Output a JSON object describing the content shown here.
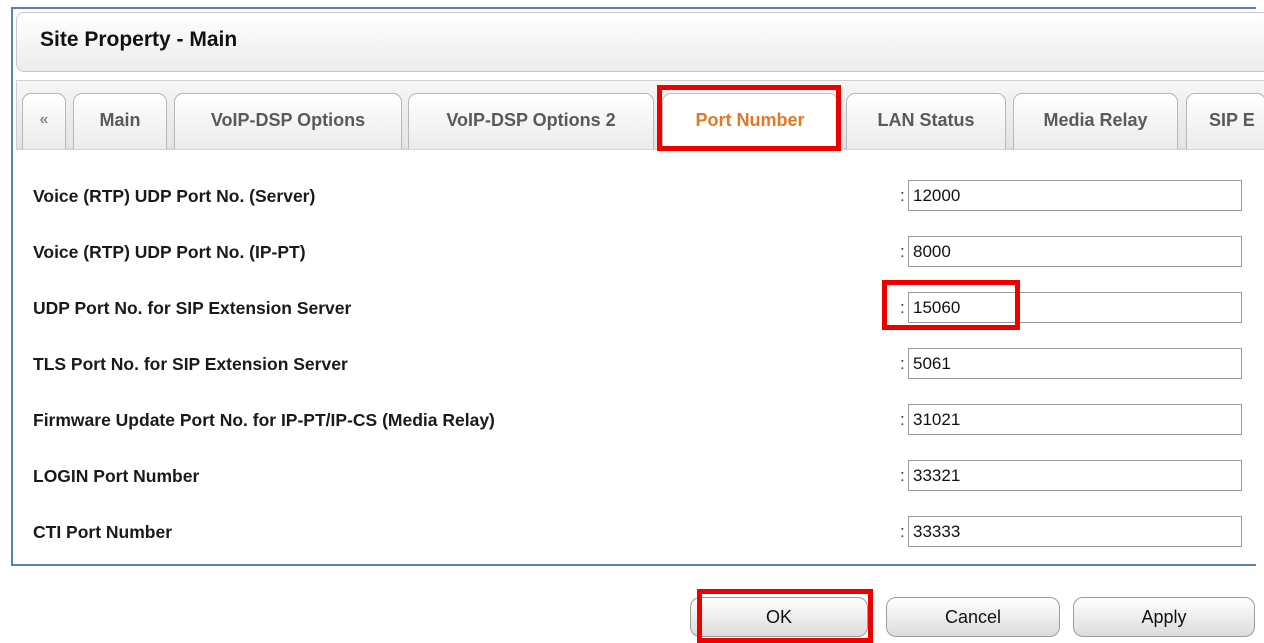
{
  "dialog": {
    "title": "Site Property - Main"
  },
  "tabs": [
    {
      "label": "«",
      "icon": "double-chevron-left-icon"
    },
    {
      "label": "Main"
    },
    {
      "label": "VoIP-DSP Options"
    },
    {
      "label": "VoIP-DSP Options 2"
    },
    {
      "label": "Port Number",
      "active": true
    },
    {
      "label": "LAN Status"
    },
    {
      "label": "Media Relay"
    },
    {
      "label": "SIP E"
    }
  ],
  "fields": [
    {
      "label": "Voice (RTP) UDP Port No. (Server)",
      "value": "12000"
    },
    {
      "label": "Voice (RTP) UDP Port No. (IP-PT)",
      "value": "8000"
    },
    {
      "label": "UDP Port No. for SIP Extension Server",
      "value": "15060"
    },
    {
      "label": "TLS Port No. for SIP Extension Server",
      "value": "5061"
    },
    {
      "label": "Firmware Update Port No. for IP-PT/IP-CS (Media Relay)",
      "value": "31021"
    },
    {
      "label": "LOGIN Port Number",
      "value": "33321"
    },
    {
      "label": "CTI Port Number",
      "value": "33333"
    }
  ],
  "separator": ":",
  "buttons": {
    "ok": "OK",
    "cancel": "Cancel",
    "apply": "Apply"
  },
  "colors": {
    "active_tab_text": "#e87722",
    "highlight": "#ee0000",
    "frame_border": "#5b7fb8"
  }
}
